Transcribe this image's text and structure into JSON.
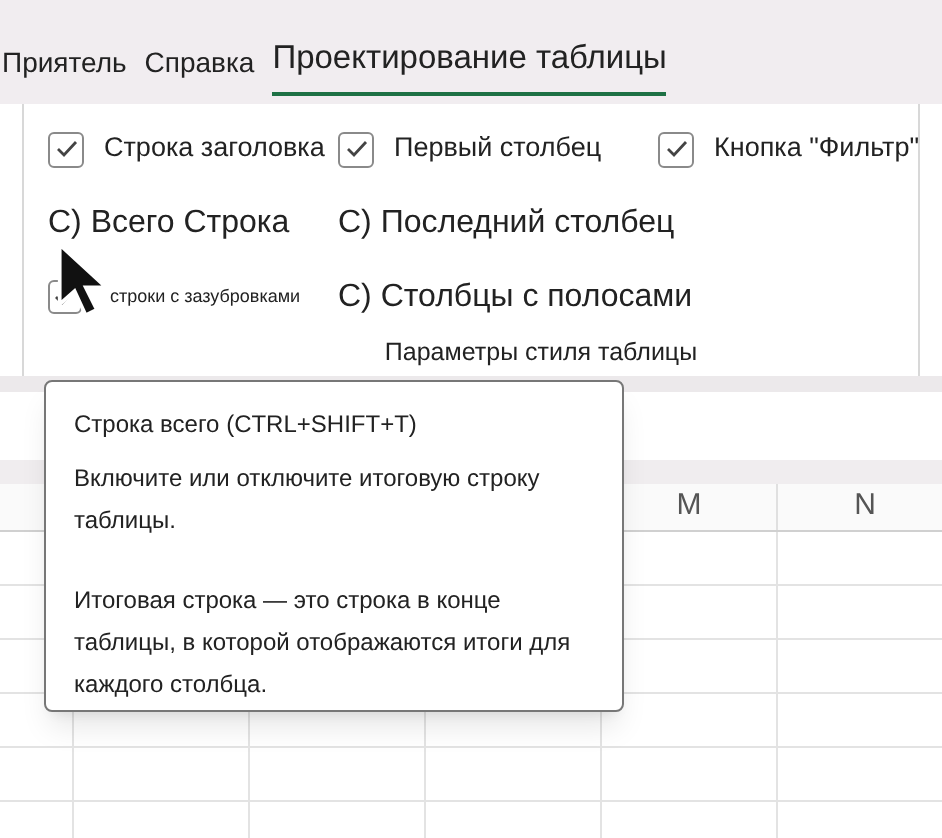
{
  "tabs": [
    {
      "label": "Приятель",
      "selected": false
    },
    {
      "label": "Справка",
      "selected": false
    },
    {
      "label": "Проектирование таблицы",
      "selected": true
    }
  ],
  "ribbon": {
    "option_columns": [
      [
        {
          "kind": "checkbox",
          "label": "Строка заголовка",
          "checked": true
        },
        {
          "kind": "text",
          "label": "С) Всего  Строка"
        },
        {
          "kind": "small-checkbox",
          "label": "строки с зазубровками",
          "checked": true
        }
      ],
      [
        {
          "kind": "checkbox",
          "label": "Первый столбец",
          "checked": true
        },
        {
          "kind": "text",
          "label": "С) Последний столбец"
        },
        {
          "kind": "text",
          "label": "С) Столбцы с полосами"
        }
      ],
      [
        {
          "kind": "checkbox",
          "label": "Кнопка \"Фильтр\"",
          "checked": true
        }
      ]
    ],
    "group_label": "Параметры стиля таблицы"
  },
  "sheet": {
    "column_headers": [
      "M",
      "N"
    ]
  },
  "tooltip": {
    "title": "Строка всего (CTRL+SHIFT+T)",
    "paragraphs": [
      "Включите или отключите итоговую строку таблицы.",
      "Итоговая строка — это строка в конце таблицы, в которой отображаются итоги для каждого столбца."
    ]
  }
}
